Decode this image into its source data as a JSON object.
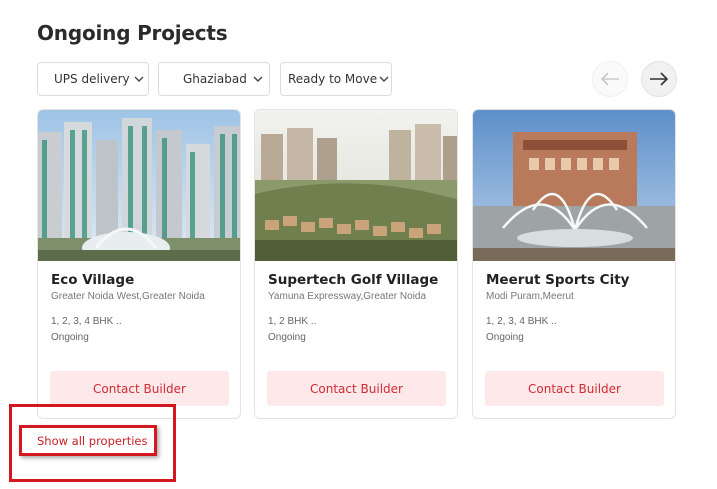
{
  "section": {
    "title": "Ongoing Projects"
  },
  "filters": [
    {
      "label": "UPS delivery",
      "icon": "chevron-down-icon"
    },
    {
      "label": "Ghaziabad",
      "icon": "chevron-down-icon"
    },
    {
      "label": "Ready to Move",
      "icon": "chevron-down-icon"
    }
  ],
  "navigation": {
    "prev_icon": "arrow-left-icon",
    "next_icon": "arrow-right-icon"
  },
  "projects": [
    {
      "name": "Eco Village",
      "location": "Greater Noida West,Greater Noida",
      "configuration": "1, 2, 3, 4 BHK ..",
      "status": "Ongoing",
      "cta": "Contact Builder"
    },
    {
      "name": "Supertech Golf Village",
      "location": "Yamuna Expressway,Greater Noida",
      "configuration": "1, 2 BHK ..",
      "status": "Ongoing",
      "cta": "Contact Builder"
    },
    {
      "name": "Meerut Sports City",
      "location": "Modi Puram,Meerut",
      "configuration": "1, 2, 3, 4 BHK ..",
      "status": "Ongoing",
      "cta": "Contact Builder"
    }
  ],
  "show_all": {
    "label": "Show all properties"
  },
  "colors": {
    "accent": "#d12a32",
    "cta_bg": "#fde9ea",
    "highlight_box": "#d4161e"
  }
}
